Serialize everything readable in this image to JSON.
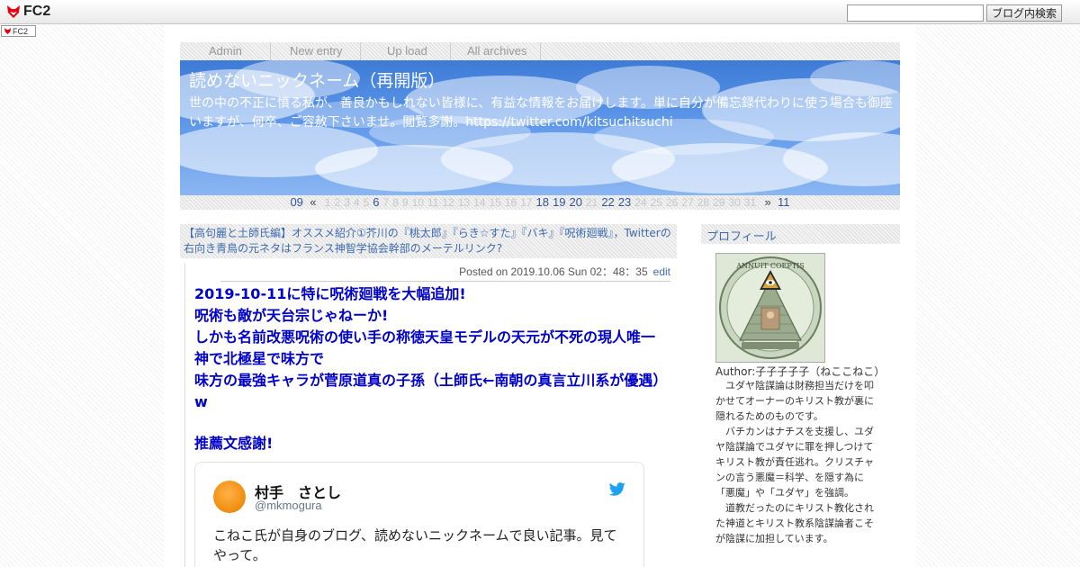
{
  "fc2bar": {
    "logo_text": "FC2",
    "search_placeholder": "",
    "search_button": "ブログ内検索",
    "mini_badge": "FC2"
  },
  "nav": {
    "items": [
      "Admin",
      "New entry",
      "Up load",
      "All archives"
    ]
  },
  "header": {
    "title": "読めないニックネーム（再開版）",
    "description": "世の中の不正に憤る私が、善良かもしれない皆様に、有益な情報をお届けします。単に自分が備忘録代わりに使う場合も御座いますが、何卒、ご容赦下さいませ。閲覧多謝。https://twitter.com/kitsuchitsuchi"
  },
  "calendar": {
    "prev_month": "09",
    "prev_symbol": "«",
    "days": [
      "1",
      "2",
      "3",
      "4",
      "5",
      "6",
      "7",
      "8",
      "9",
      "10",
      "11",
      "12",
      "13",
      "14",
      "15",
      "16",
      "17",
      "18",
      "19",
      "20",
      "21",
      "22",
      "23",
      "24",
      "25",
      "26",
      "27",
      "28",
      "29",
      "30",
      "31"
    ],
    "linked_days": [
      "6",
      "18",
      "19",
      "20",
      "22",
      "23"
    ],
    "next_symbol": "»",
    "next_month": "11"
  },
  "entry": {
    "title": "【高句麗と土師氏編】オススメ紹介①芥川の『桃太郎』『らき☆すた』『バキ』『呪術廻戦』，Twitterの右向き青鳥の元ネタはフランス神智学協会幹部のメーテルリンク?",
    "posted": "Posted on 2019.10.06 Sun 02：48：35",
    "edit": "edit",
    "lines": [
      "2019-10-11に特に呪術廻戦を大幅追加!",
      "呪術も敵が天台宗じゃねーか!",
      "しかも名前改悪呪術の使い手の称徳天皇モデルの天元が不死の現人唯一神で北極星で味方で",
      "味方の最強キャラが菅原道真の子孫（土師氏←南朝の真言立川系が優遇）w"
    ],
    "recommend": "推薦文感謝!",
    "tweet": {
      "name": "村手　さとし",
      "handle": "@mkmogura",
      "text": "こねこ氏が自身のブログ、読めないニックネームで良い記事。見てやって。"
    }
  },
  "sidebar": {
    "profile_title": "プロフィール",
    "image_text": "ANNUIT COEPTIS",
    "author": "Author:子子子子子（ねここねこ）",
    "paragraphs": [
      "ユダヤ陰謀論は財務担当だけを叩かせてオーナーのキリスト教が裏に隠れるためのものです。",
      "バチカンはナチスを支援し、ユダヤ陰謀論でユダヤに罪を押しつけてキリスト教が責任逃れ。クリスチャンの言う悪魔＝科学、を隠す為に「悪魔」や「ユダヤ」を強調。",
      "道教だったのにキリスト教化された神道とキリスト教系陰謀論者こそが陰謀に加担しています。"
    ]
  },
  "colors": {
    "link": "#3d6ab0",
    "entry_text": "#0000cc",
    "header_sky": "#4f8be0",
    "twitter_blue": "#1da1f2",
    "avatar_orange": "#f39418"
  }
}
